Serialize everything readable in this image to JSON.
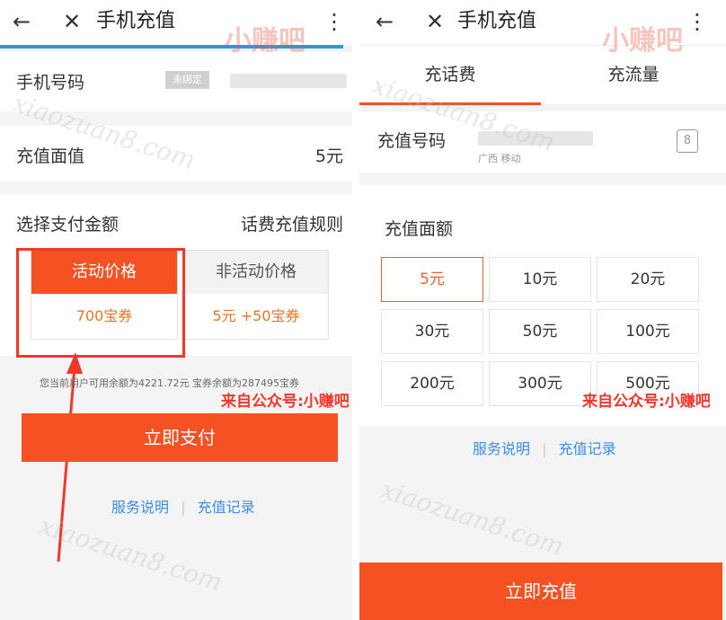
{
  "left": {
    "appbar": {
      "back_icon": "←",
      "close_icon": "✕",
      "title": "手机充值",
      "more_icon": "⋮"
    },
    "phone_row": {
      "label": "手机号码",
      "tag": "未绑定"
    },
    "amount_row": {
      "label": "充值面值",
      "value": "5元"
    },
    "payment": {
      "heading": "选择支付金额",
      "rules_link": "话费充值规则",
      "promo": {
        "title": "活动价格",
        "price": "700宝券"
      },
      "regular": {
        "title": "非活动价格",
        "price_cash": "5元",
        "price_bonus": "+50宝券"
      }
    },
    "balance_note": "您当前用户可用余额为4221.72元 宝券余额为287495宝券",
    "annotation": "来自公众号:小赚吧",
    "pay_button": "立即支付",
    "footer": {
      "service": "服务说明",
      "separator": "|",
      "records": "充值记录"
    }
  },
  "right": {
    "appbar": {
      "back_icon": "←",
      "close_icon": "✕",
      "title": "手机充值",
      "more_icon": "⋮"
    },
    "tabs": [
      {
        "label": "充话费"
      },
      {
        "label": "充流量"
      }
    ],
    "phone_row": {
      "label": "充值号码",
      "carrier": "广西 移动",
      "contact_icon": "8"
    },
    "amounts": {
      "heading": "充值面额",
      "options": [
        "5元",
        "10元",
        "20元",
        "30元",
        "50元",
        "100元",
        "200元",
        "300元",
        "500元"
      ],
      "selected": "5元"
    },
    "annotation": "来自公众号:小赚吧",
    "footer": {
      "service": "服务说明",
      "separator": "|",
      "records": "充值记录"
    },
    "recharge_button": "立即充值"
  },
  "watermark": {
    "site": "xiaozuan8.com",
    "brand": "小赚吧"
  },
  "colors": {
    "accent": "#f55223",
    "link": "#3a8ee6",
    "progress": "#2c9ad6",
    "annotation": "#f0372a"
  }
}
